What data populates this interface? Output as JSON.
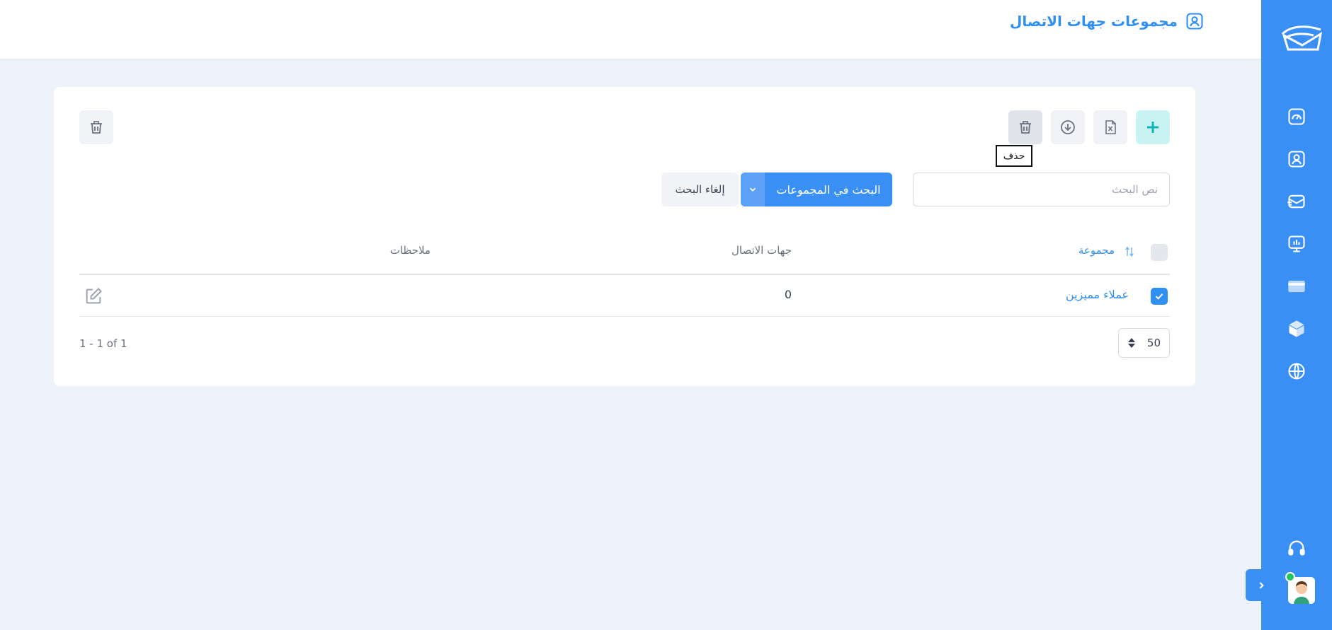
{
  "header": {
    "title": "مجموعات جهات الاتصال"
  },
  "toolbar": {
    "tooltip": "حذف",
    "buttons": [
      "plus-icon",
      "excel-file-icon",
      "download-icon",
      "trash-icon"
    ],
    "bulk_delete": "trash-icon"
  },
  "search": {
    "placeholder": "نص البحث",
    "value": "",
    "search_label": "البحث في المجموعات",
    "cancel_label": "إلغاء البحث"
  },
  "table": {
    "columns": {
      "group": "مجموعة",
      "contacts": "جهات الاتصال",
      "notes": "ملاحظات"
    },
    "rows": [
      {
        "name": "عملاء مميزين",
        "contacts": "0",
        "notes": "",
        "checked": true
      }
    ]
  },
  "pagination": {
    "page_size": "50",
    "summary": "1 - 1 of 1"
  },
  "sidebar": {
    "items": [
      "dashboard-icon",
      "contacts-icon",
      "messages-icon",
      "reports-icon",
      "billing-icon",
      "packages-icon",
      "globe-icon"
    ],
    "bottom": [
      "headset-icon",
      "avatar"
    ]
  },
  "colors": {
    "primary": "#3a8ff5",
    "background": "#eef3fb",
    "accent_teal": "#0fb5b5"
  }
}
